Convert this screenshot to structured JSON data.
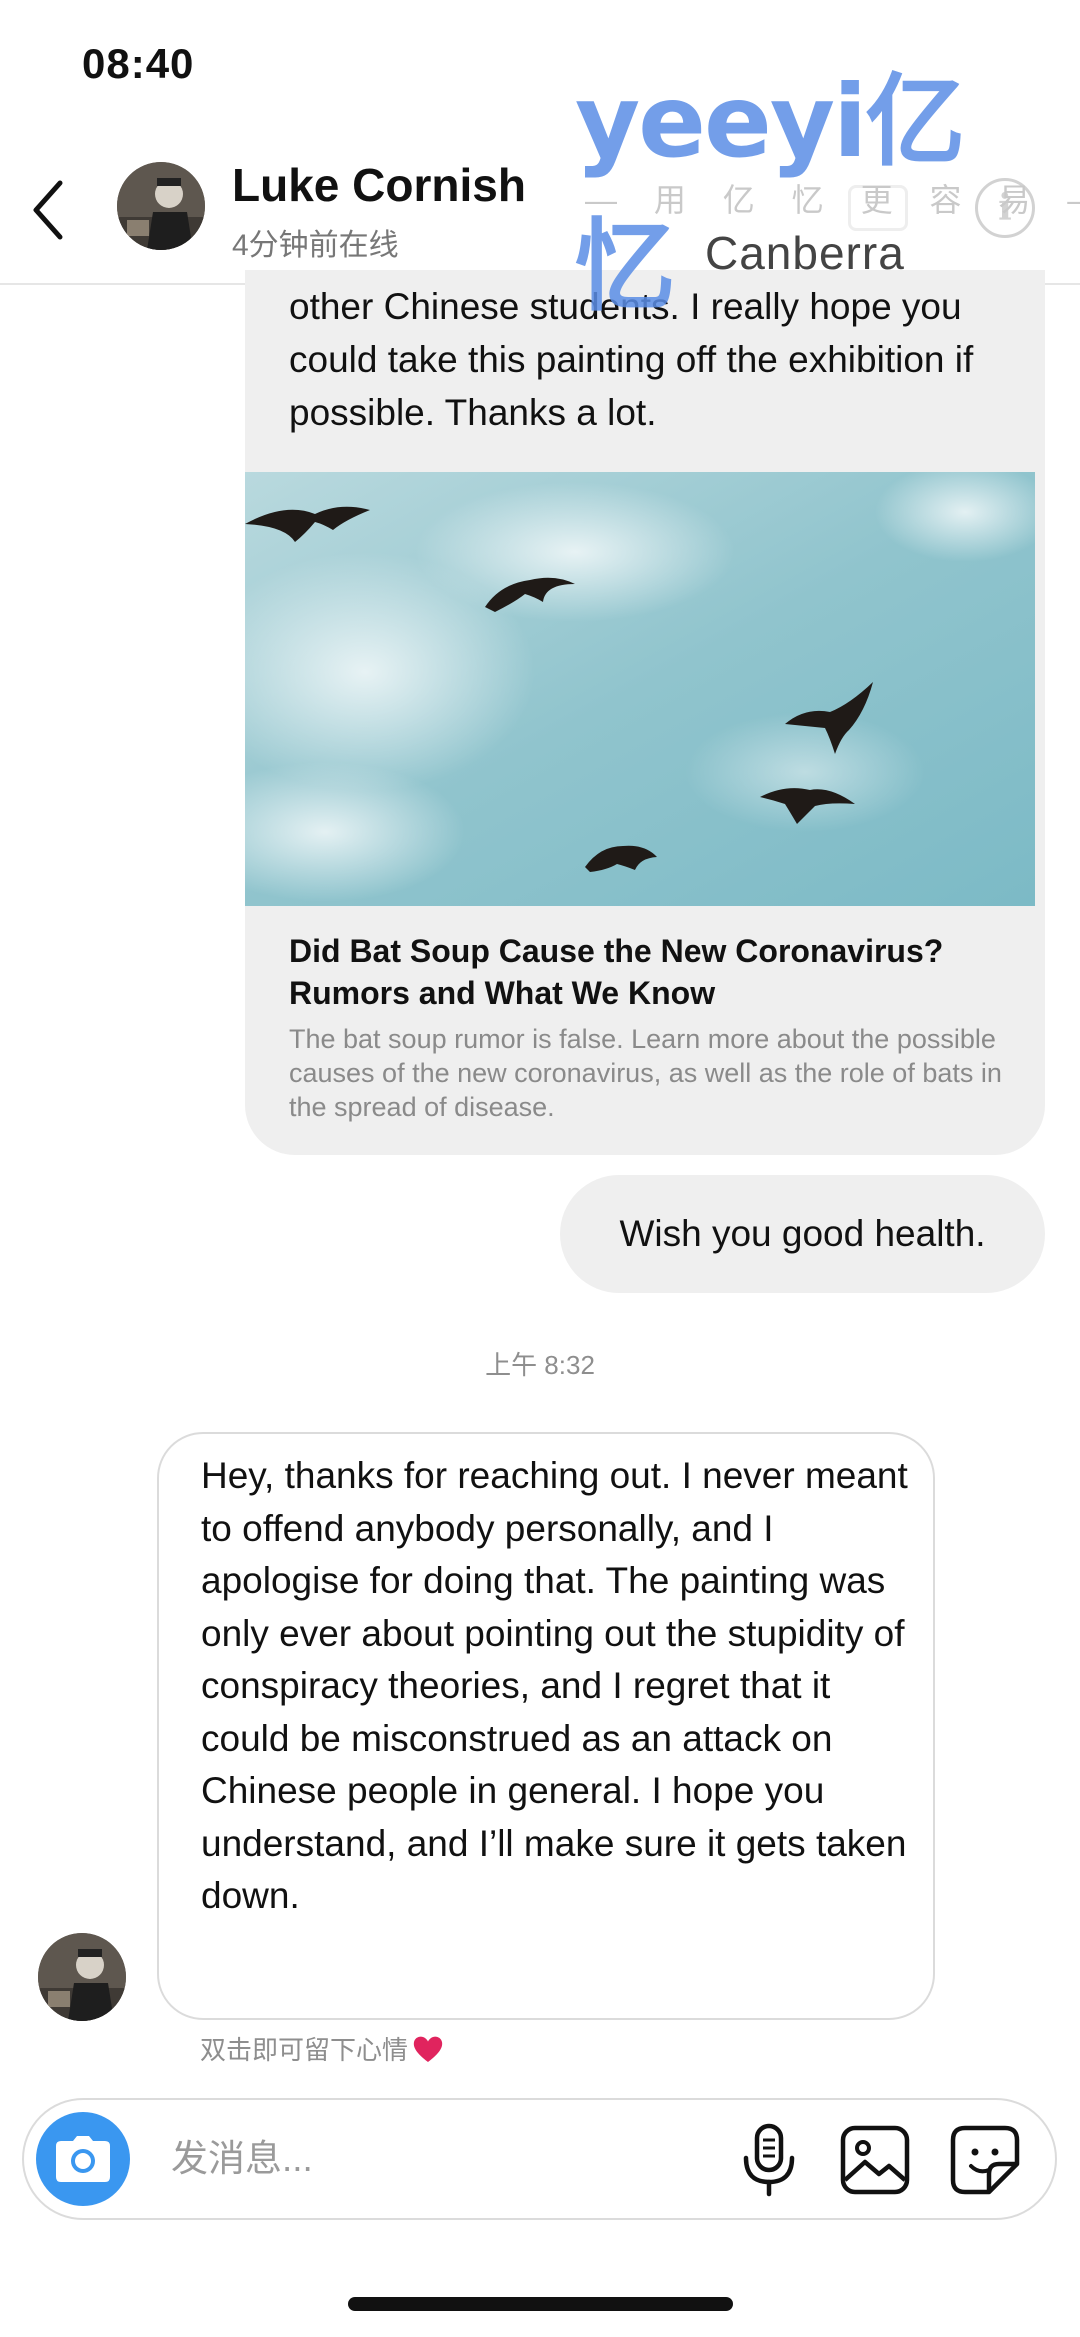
{
  "status_bar": {
    "time": "08:40"
  },
  "watermark": {
    "logo": "yeeyi亿忆",
    "tagline": "— 用 亿 忆 更 容 易 —",
    "city": "Canberra"
  },
  "header": {
    "name": "Luke Cornish",
    "status": "4分钟前在线",
    "info_glyph": "i"
  },
  "shared_card": {
    "message_text": "other Chinese students. I really hope you could take this painting off the exhibition if possible. Thanks a lot.",
    "link_title": "Did Bat Soup Cause the New Coronavirus? Rumors and What We Know",
    "link_description": "The bat soup rumor is false. Learn more about the possible causes of the new coronavirus, as well as the role of bats in the spread of disease."
  },
  "outgoing_message": "Wish you good health.",
  "timestamp": "上午 8:32",
  "incoming_message": "Hey, thanks for reaching out. I never meant to offend anybody personally, and I apologise for doing that. The painting was only ever about pointing out the stupidity of conspiracy theories, and I regret that it could be misconstrued as an attack on Chinese people in general. I hope you understand, and I’ll make sure it gets taken down.",
  "reaction_hint": "双击即可留下心情",
  "composer": {
    "placeholder": "发消息..."
  },
  "colors": {
    "accent": "#3a97f0",
    "bubble": "#efefef",
    "sky": "#8cc3cd",
    "heart": "#e0245e"
  }
}
